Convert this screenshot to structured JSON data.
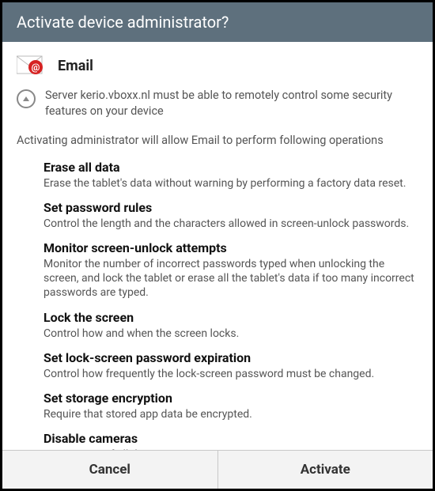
{
  "title": "Activate device administrator?",
  "app": {
    "name": "Email"
  },
  "server_notice": "Server kerio.vboxx.nl must be able to remotely control some security features on your device",
  "intro": "Activating administrator will allow Email to perform following operations",
  "permissions": [
    {
      "title": "Erase all data",
      "desc": "Erase the tablet's data without warning by performing a factory data reset."
    },
    {
      "title": "Set password rules",
      "desc": "Control the length and the characters allowed in screen-unlock passwords."
    },
    {
      "title": "Monitor screen-unlock attempts",
      "desc": "Monitor the number of incorrect passwords typed when unlocking the screen, and lock the tablet or erase all the tablet's data if too many incorrect passwords are typed."
    },
    {
      "title": "Lock the screen",
      "desc": "Control how and when the screen locks."
    },
    {
      "title": "Set lock-screen password expiration",
      "desc": "Control how frequently the lock-screen password must be changed."
    },
    {
      "title": "Set storage encryption",
      "desc": "Require that stored app data be encrypted."
    },
    {
      "title": "Disable cameras",
      "desc": "Prevent use of all device cameras."
    }
  ],
  "buttons": {
    "cancel": "Cancel",
    "activate": "Activate"
  }
}
